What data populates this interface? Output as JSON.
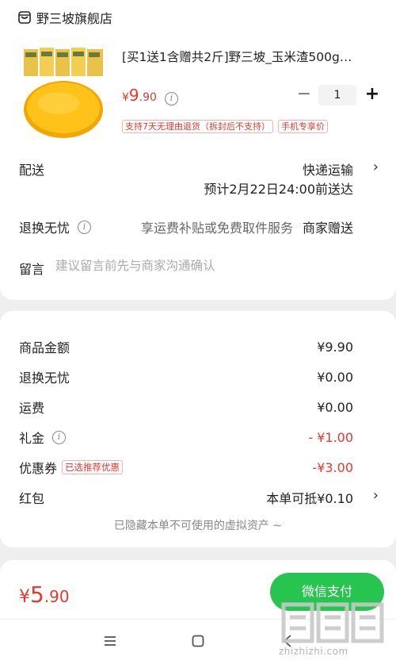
{
  "shop": {
    "name": "野三坡旗舰店",
    "icon": "store-icon"
  },
  "product": {
    "title": "[买1送1含赠共2斤]野三坡_玉米渣500g…",
    "price": {
      "symbol": "¥",
      "integer": "9",
      "decimal": ".90"
    },
    "quantity": "1",
    "tags": [
      "支持7天无理由退货（拆封后不支持）",
      "手机专享价"
    ]
  },
  "delivery": {
    "label": "配送",
    "method": "快递运输",
    "eta": "预计2月22日24:00前送达"
  },
  "return_service": {
    "label": "退换无忧",
    "hint": "享运费补贴或免费取件服务",
    "value": "商家赠送"
  },
  "message": {
    "label": "留言",
    "placeholder": "建议留言前先与商家沟通确认"
  },
  "summary": {
    "goods_amount": {
      "label": "商品金额",
      "value": "¥9.90"
    },
    "return_service": {
      "label": "退换无忧",
      "value": "¥0.00"
    },
    "shipping": {
      "label": "运费",
      "value": "¥0.00"
    },
    "gift": {
      "label": "礼金",
      "value": "- ¥1.00"
    },
    "coupon": {
      "label": "优惠券",
      "badge": "已选推荐优惠",
      "value": "-¥3.00"
    },
    "red_packet": {
      "label": "红包",
      "value": "本单可抵¥0.10"
    },
    "hidden_assets": "已隐藏本单不可使用的虚拟资产 ~"
  },
  "footer": {
    "total": {
      "symbol": "¥",
      "integer": "5",
      "decimal": ".90"
    },
    "pay_button": "微信支付"
  },
  "watermark": {
    "text": "zhizhizhi.com"
  },
  "colors": {
    "price_red": "#e23b2f",
    "pay_green": "#27c44f",
    "background": "#efefef"
  }
}
